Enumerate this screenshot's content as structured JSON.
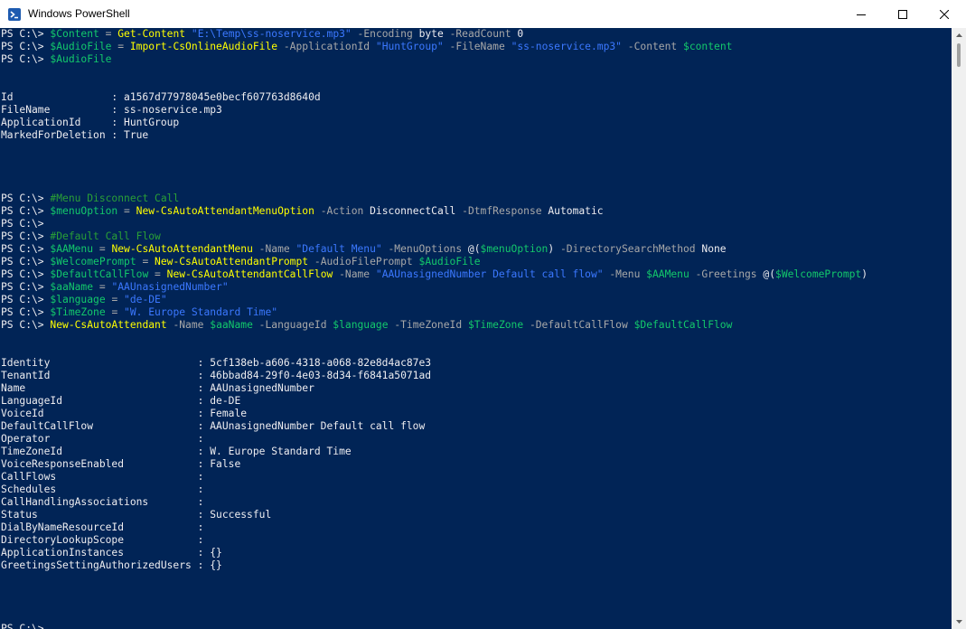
{
  "window": {
    "title": "Windows PowerShell",
    "icon": "powershell-icon",
    "controls": [
      "minimize-icon",
      "maximize-icon",
      "close-icon"
    ]
  },
  "colors": {
    "background": "#012456",
    "text": "#eeedf0",
    "cmdlet": "#ffff00",
    "variable": "#13c96b",
    "string": "#3b78ff",
    "parameter": "#a8a8a8",
    "comment": "#2aa036"
  },
  "console": {
    "lines": [
      [
        [
          "w",
          "PS C:\\> "
        ],
        [
          "g",
          "$Content"
        ],
        [
          "o",
          " = "
        ],
        [
          "y",
          "Get-Content"
        ],
        [
          "w",
          " "
        ],
        [
          "s",
          "\"E:\\Temp\\ss-noservice.mp3\""
        ],
        [
          "p",
          " -Encoding "
        ],
        [
          "w",
          "byte"
        ],
        [
          "p",
          " -ReadCount "
        ],
        [
          "w",
          "0"
        ]
      ],
      [
        [
          "w",
          "PS C:\\> "
        ],
        [
          "g",
          "$AudioFile"
        ],
        [
          "o",
          " = "
        ],
        [
          "y",
          "Import-CsOnlineAudioFile"
        ],
        [
          "p",
          " -ApplicationId "
        ],
        [
          "s",
          "\"HuntGroup\""
        ],
        [
          "p",
          " -FileName "
        ],
        [
          "s",
          "\"ss-noservice.mp3\""
        ],
        [
          "p",
          " -Content "
        ],
        [
          "g",
          "$content"
        ]
      ],
      [
        [
          "w",
          "PS C:\\> "
        ],
        [
          "g",
          "$AudioFile"
        ]
      ],
      [],
      [],
      [
        [
          "w",
          "Id                : a1567d77978045e0becf607763d8640d"
        ]
      ],
      [
        [
          "w",
          "FileName          : ss-noservice.mp3"
        ]
      ],
      [
        [
          "w",
          "ApplicationId     : HuntGroup"
        ]
      ],
      [
        [
          "w",
          "MarkedForDeletion : True"
        ]
      ],
      [],
      [],
      [],
      [],
      [
        [
          "w",
          "PS C:\\> "
        ],
        [
          "c",
          "#Menu Disconnect Call"
        ]
      ],
      [
        [
          "w",
          "PS C:\\> "
        ],
        [
          "g",
          "$menuOption"
        ],
        [
          "o",
          " = "
        ],
        [
          "y",
          "New-CsAutoAttendantMenuOption"
        ],
        [
          "p",
          " -Action "
        ],
        [
          "w",
          "DisconnectCall"
        ],
        [
          "p",
          " -DtmfResponse "
        ],
        [
          "w",
          "Automatic"
        ]
      ],
      [
        [
          "w",
          "PS C:\\>"
        ]
      ],
      [
        [
          "w",
          "PS C:\\> "
        ],
        [
          "c",
          "#Default Call Flow"
        ]
      ],
      [
        [
          "w",
          "PS C:\\> "
        ],
        [
          "g",
          "$AAMenu"
        ],
        [
          "o",
          " = "
        ],
        [
          "y",
          "New-CsAutoAttendantMenu"
        ],
        [
          "p",
          " -Name "
        ],
        [
          "s",
          "\"Default Menu\""
        ],
        [
          "p",
          " -MenuOptions "
        ],
        [
          "w",
          "@("
        ],
        [
          "g",
          "$menuOption"
        ],
        [
          "w",
          ")"
        ],
        [
          "p",
          " -DirectorySearchMethod "
        ],
        [
          "w",
          "None"
        ]
      ],
      [
        [
          "w",
          "PS C:\\> "
        ],
        [
          "g",
          "$WelcomePrompt"
        ],
        [
          "o",
          " = "
        ],
        [
          "y",
          "New-CsAutoAttendantPrompt"
        ],
        [
          "p",
          " -AudioFilePrompt "
        ],
        [
          "g",
          "$AudioFile"
        ]
      ],
      [
        [
          "w",
          "PS C:\\> "
        ],
        [
          "g",
          "$DefaultCallFlow"
        ],
        [
          "o",
          " = "
        ],
        [
          "y",
          "New-CsAutoAttendantCallFlow"
        ],
        [
          "p",
          " -Name "
        ],
        [
          "s",
          "\"AAUnasignedNumber Default call flow\""
        ],
        [
          "p",
          " -Menu "
        ],
        [
          "g",
          "$AAMenu"
        ],
        [
          "p",
          " -Greetings "
        ],
        [
          "w",
          "@("
        ],
        [
          "g",
          "$WelcomePrompt"
        ],
        [
          "w",
          ")"
        ]
      ],
      [
        [
          "w",
          "PS C:\\> "
        ],
        [
          "g",
          "$aaName"
        ],
        [
          "o",
          " = "
        ],
        [
          "s",
          "\"AAUnasignedNumber\""
        ]
      ],
      [
        [
          "w",
          "PS C:\\> "
        ],
        [
          "g",
          "$language"
        ],
        [
          "o",
          " = "
        ],
        [
          "s",
          "\"de-DE\""
        ]
      ],
      [
        [
          "w",
          "PS C:\\> "
        ],
        [
          "g",
          "$TimeZone"
        ],
        [
          "o",
          " = "
        ],
        [
          "s",
          "\"W. Europe Standard Time\""
        ]
      ],
      [
        [
          "w",
          "PS C:\\> "
        ],
        [
          "y",
          "New-CsAutoAttendant"
        ],
        [
          "p",
          " -Name "
        ],
        [
          "g",
          "$aaName"
        ],
        [
          "p",
          " -LanguageId "
        ],
        [
          "g",
          "$language"
        ],
        [
          "p",
          " -TimeZoneId "
        ],
        [
          "g",
          "$TimeZone"
        ],
        [
          "p",
          " -DefaultCallFlow "
        ],
        [
          "g",
          "$DefaultCallFlow"
        ]
      ],
      [],
      [],
      [
        [
          "w",
          "Identity                        : 5cf138eb-a606-4318-a068-82e8d4ac87e3"
        ]
      ],
      [
        [
          "w",
          "TenantId                        : 46bbad84-29f0-4e03-8d34-f6841a5071ad"
        ]
      ],
      [
        [
          "w",
          "Name                            : AAUnasignedNumber"
        ]
      ],
      [
        [
          "w",
          "LanguageId                      : de-DE"
        ]
      ],
      [
        [
          "w",
          "VoiceId                         : Female"
        ]
      ],
      [
        [
          "w",
          "DefaultCallFlow                 : AAUnasignedNumber Default call flow"
        ]
      ],
      [
        [
          "w",
          "Operator                        :"
        ]
      ],
      [
        [
          "w",
          "TimeZoneId                      : W. Europe Standard Time"
        ]
      ],
      [
        [
          "w",
          "VoiceResponseEnabled            : False"
        ]
      ],
      [
        [
          "w",
          "CallFlows                       :"
        ]
      ],
      [
        [
          "w",
          "Schedules                       :"
        ]
      ],
      [
        [
          "w",
          "CallHandlingAssociations        :"
        ]
      ],
      [
        [
          "w",
          "Status                          : Successful"
        ]
      ],
      [
        [
          "w",
          "DialByNameResourceId            :"
        ]
      ],
      [
        [
          "w",
          "DirectoryLookupScope            :"
        ]
      ],
      [
        [
          "w",
          "ApplicationInstances            : {}"
        ]
      ],
      [
        [
          "w",
          "GreetingsSettingAuthorizedUsers : {}"
        ]
      ],
      [],
      [],
      [],
      [],
      [
        [
          "w",
          "PS C:\\>"
        ]
      ]
    ]
  }
}
